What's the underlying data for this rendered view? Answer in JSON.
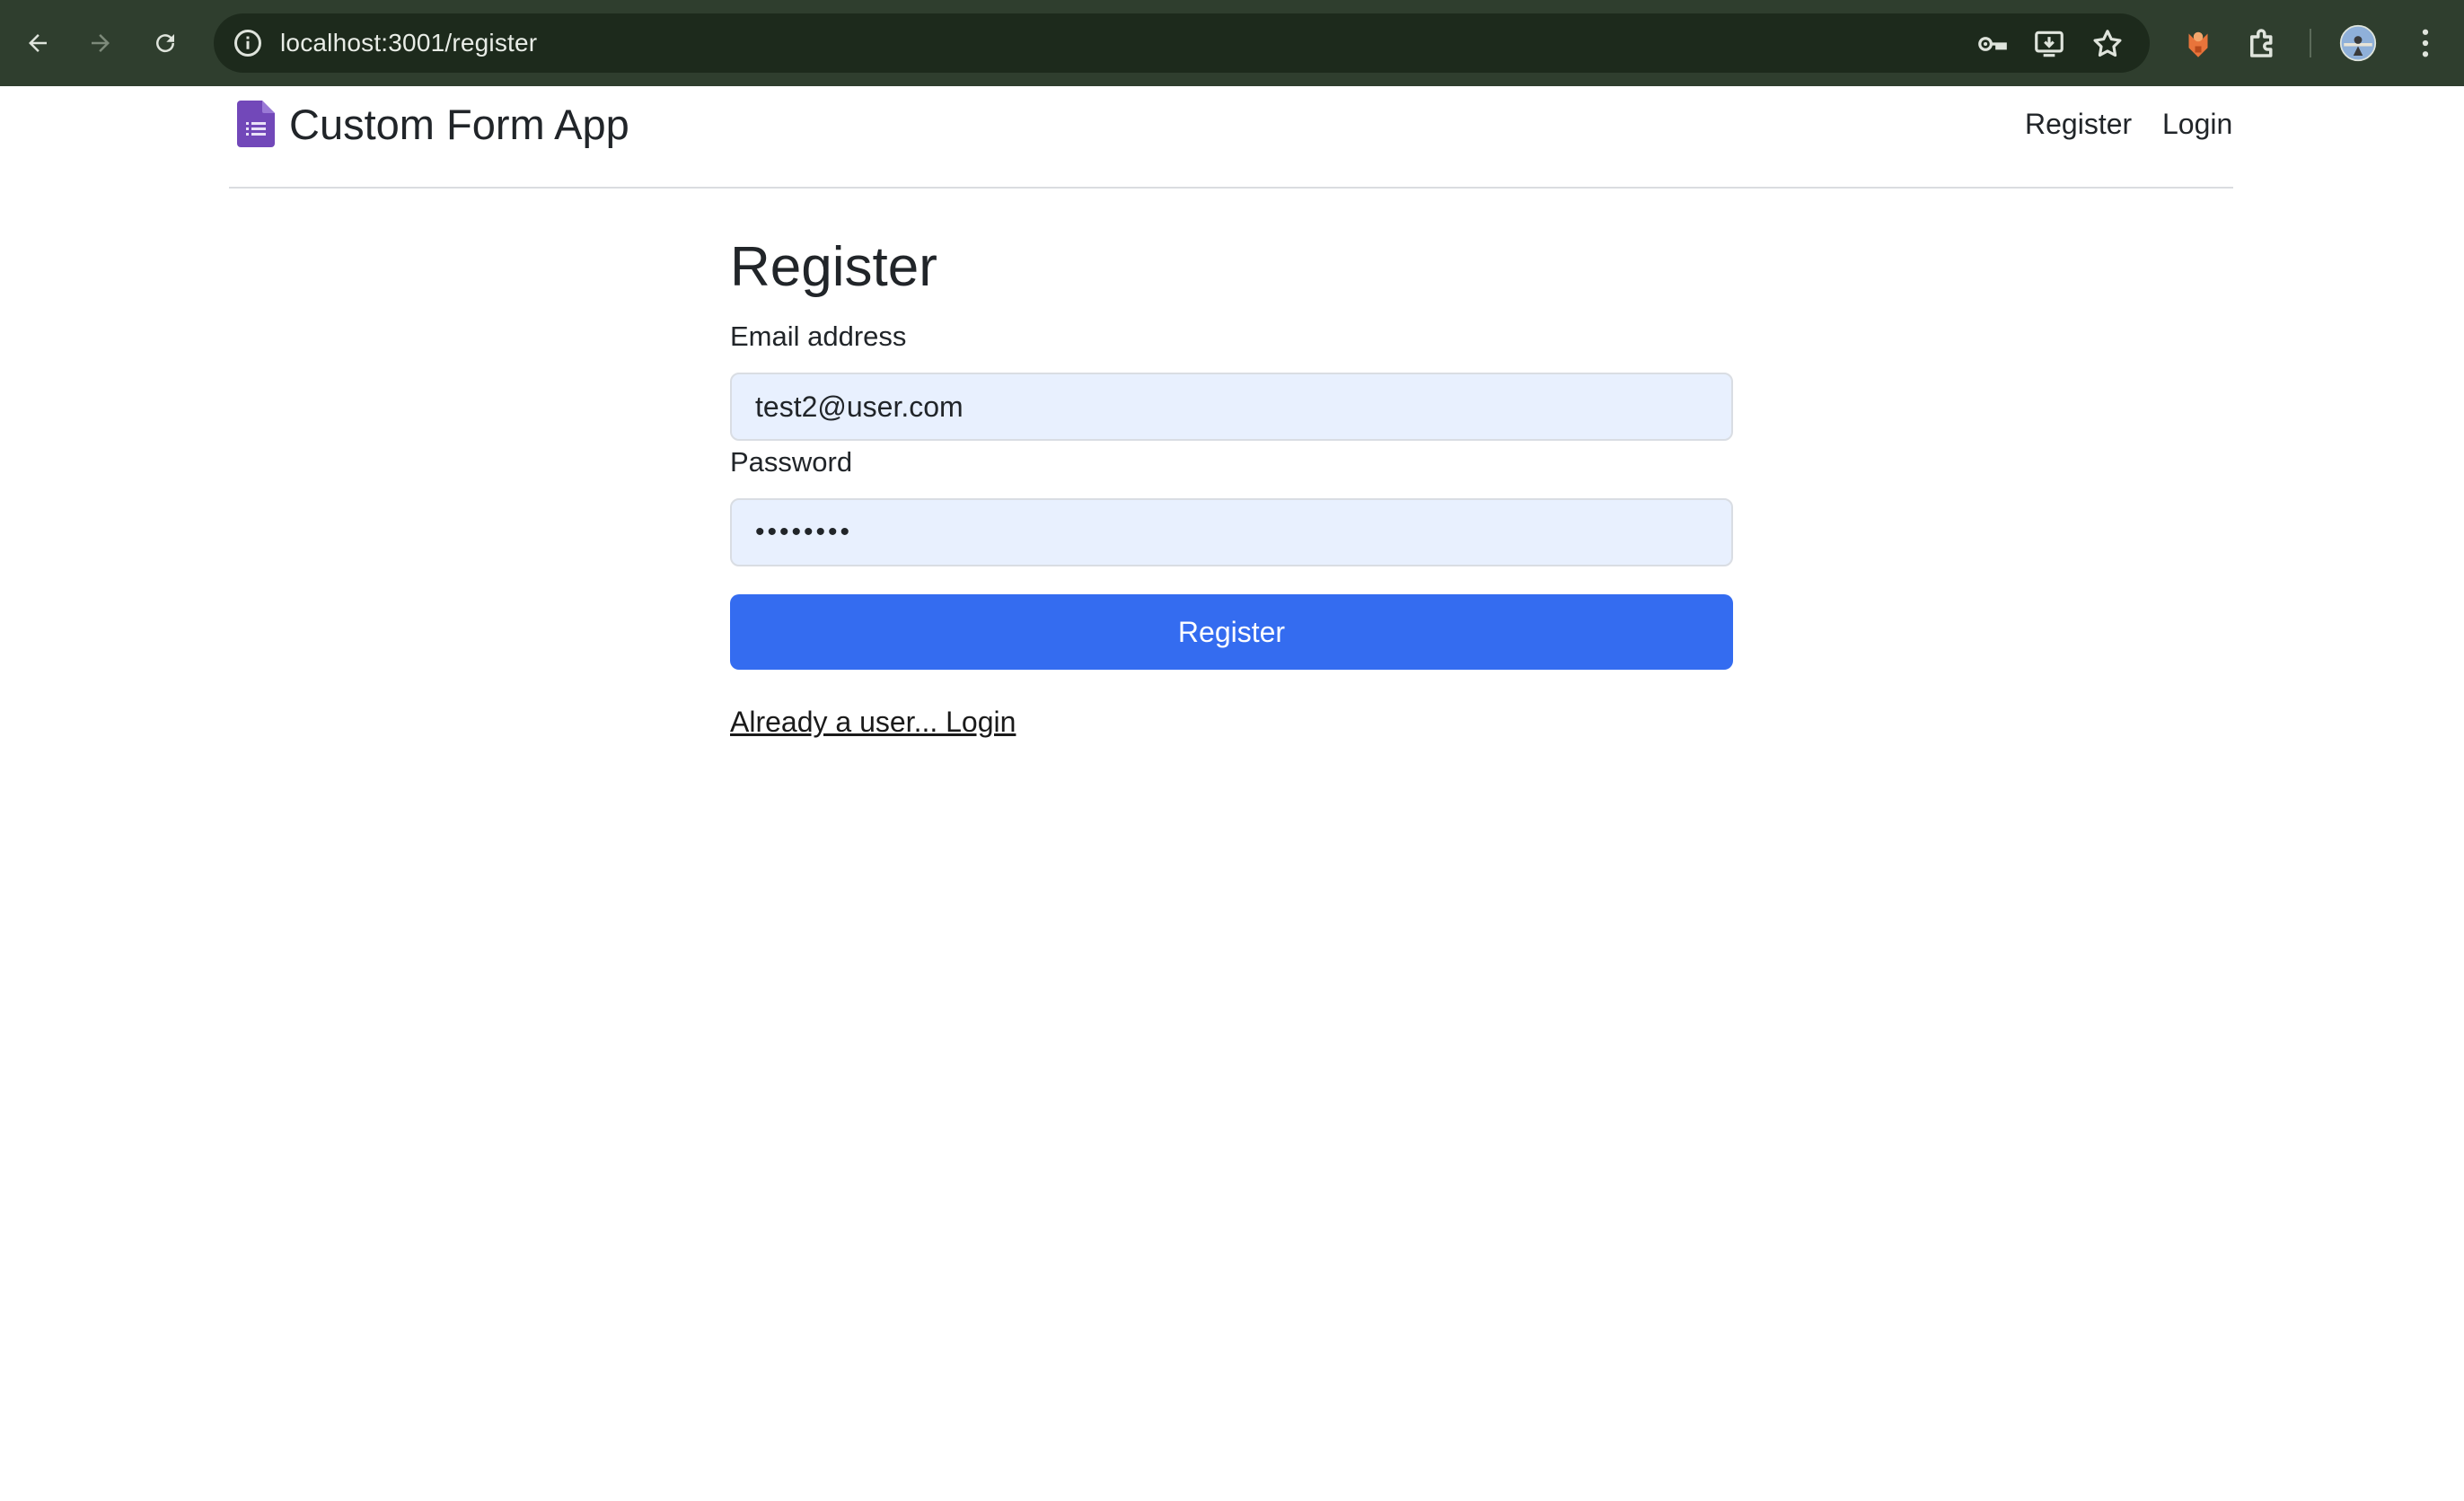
{
  "browser": {
    "url": "localhost:3001/register",
    "icons": [
      "back-arrow-icon",
      "forward-arrow-icon",
      "reload-icon",
      "site-info-icon",
      "password-key-icon",
      "install-app-icon",
      "bookmark-star-icon",
      "extension-fox-icon",
      "extensions-puzzle-icon",
      "profile-avatar",
      "more-menu-icon"
    ]
  },
  "navbar": {
    "brand": "Custom Form App",
    "links": [
      "Register",
      "Login"
    ]
  },
  "form": {
    "title": "Register",
    "email_label": "Email address",
    "email_value": "test2@user.com",
    "password_label": "Password",
    "password_value": "••••••••",
    "submit_label": "Register",
    "login_link": "Already a user... Login"
  },
  "colors": {
    "chrome_bg": "#2f3e2e",
    "omnibox_bg": "#1d2a1c",
    "brand_icon": "#7248b9",
    "input_bg": "#e8f0fe",
    "primary_button": "#346cf0"
  }
}
